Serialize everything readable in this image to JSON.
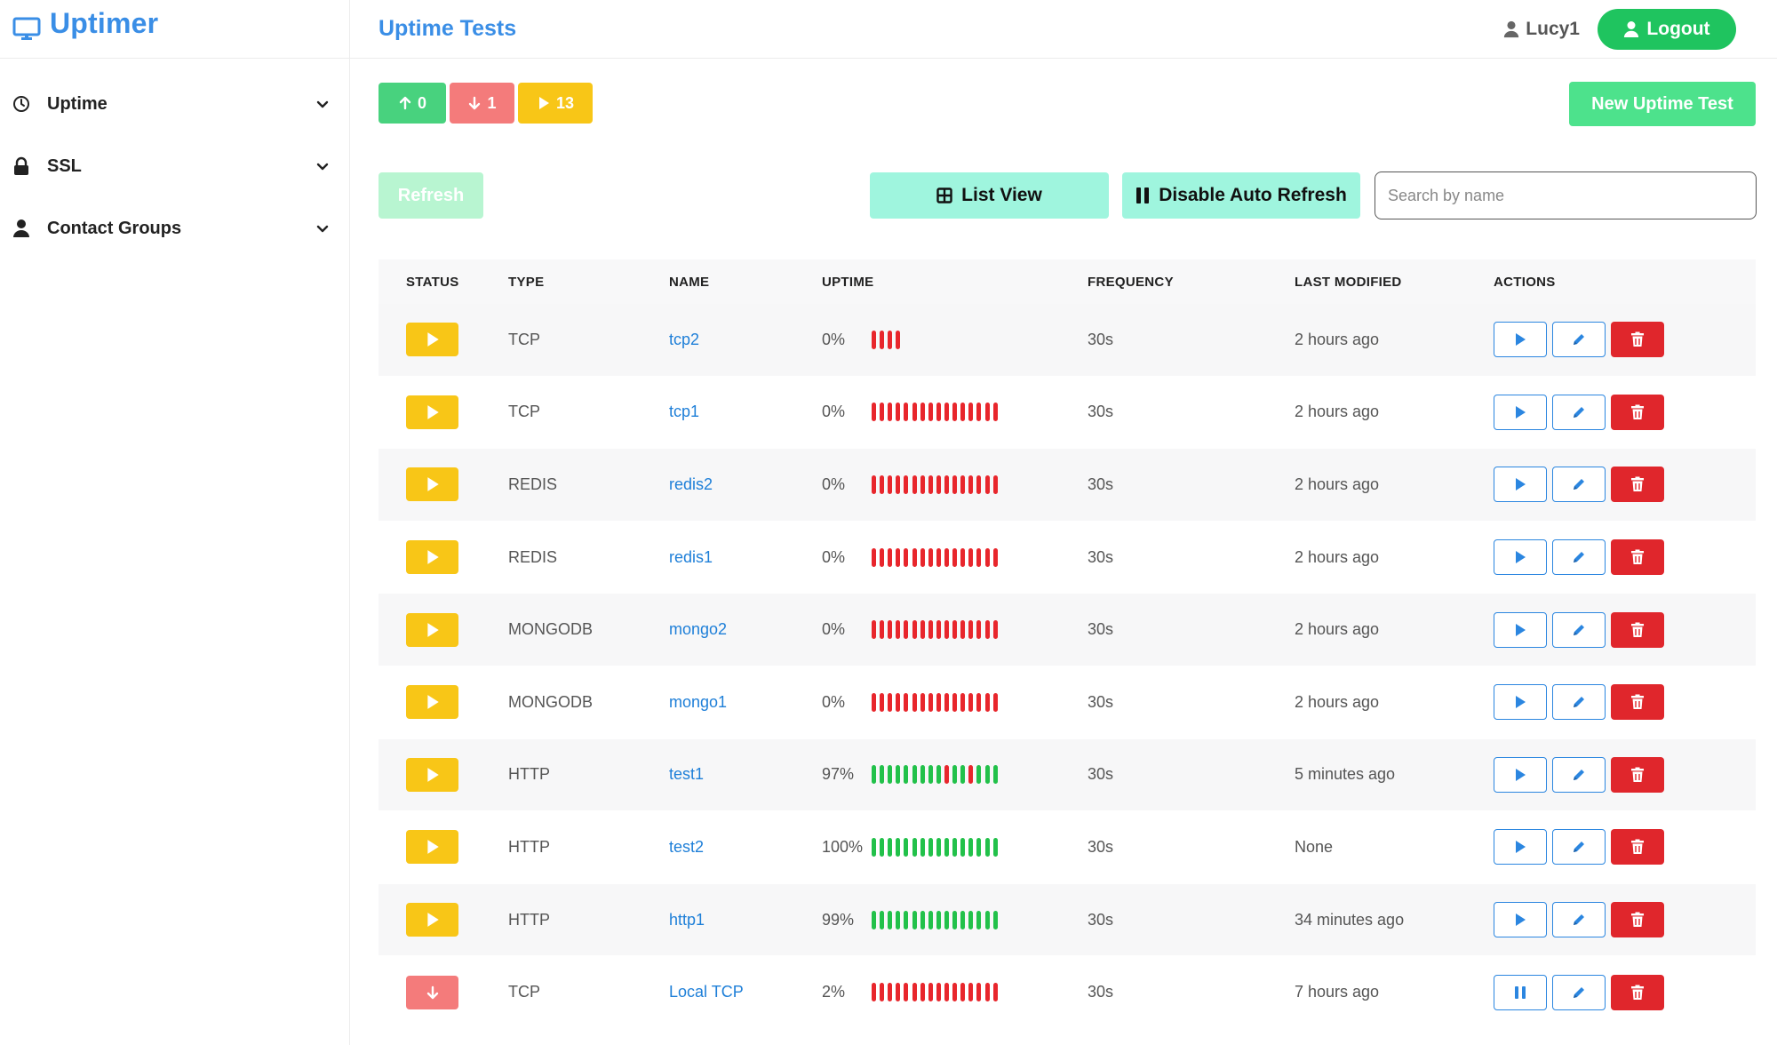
{
  "app": {
    "name": "Uptimer"
  },
  "sidebar": {
    "items": [
      {
        "label": "Uptime",
        "icon": "clock-icon"
      },
      {
        "label": "SSL",
        "icon": "lock-icon"
      },
      {
        "label": "Contact Groups",
        "icon": "user-icon"
      }
    ]
  },
  "header": {
    "title": "Uptime Tests",
    "user": "Lucy1",
    "logout_label": "Logout"
  },
  "summary": {
    "up_count": "0",
    "down_count": "1",
    "paused_count": "13"
  },
  "toolbar": {
    "new_test_label": "New Uptime Test",
    "refresh_label": "Refresh",
    "list_view_label": "List View",
    "auto_refresh_label": "Disable Auto Refresh",
    "search_placeholder": "Search by name"
  },
  "table": {
    "headers": [
      "STATUS",
      "TYPE",
      "NAME",
      "UPTIME",
      "FREQUENCY",
      "LAST MODIFIED",
      "ACTIONS"
    ],
    "rows": [
      {
        "status": "paused",
        "type": "TCP",
        "name": "tcp2",
        "uptime": "0%",
        "heartbeats": "FFFF",
        "frequency": "30s",
        "last_modified": "2 hours ago"
      },
      {
        "status": "paused",
        "type": "TCP",
        "name": "tcp1",
        "uptime": "0%",
        "heartbeats": "FFFFFFFFFFFFFFFF",
        "frequency": "30s",
        "last_modified": "2 hours ago"
      },
      {
        "status": "paused",
        "type": "REDIS",
        "name": "redis2",
        "uptime": "0%",
        "heartbeats": "FFFFFFFFFFFFFFFF",
        "frequency": "30s",
        "last_modified": "2 hours ago"
      },
      {
        "status": "paused",
        "type": "REDIS",
        "name": "redis1",
        "uptime": "0%",
        "heartbeats": "FFFFFFFFFFFFFFFF",
        "frequency": "30s",
        "last_modified": "2 hours ago"
      },
      {
        "status": "paused",
        "type": "MONGODB",
        "name": "mongo2",
        "uptime": "0%",
        "heartbeats": "FFFFFFFFFFFFFFFF",
        "frequency": "30s",
        "last_modified": "2 hours ago"
      },
      {
        "status": "paused",
        "type": "MONGODB",
        "name": "mongo1",
        "uptime": "0%",
        "heartbeats": "FFFFFFFFFFFFFFFF",
        "frequency": "30s",
        "last_modified": "2 hours ago"
      },
      {
        "status": "paused",
        "type": "HTTP",
        "name": "test1",
        "uptime": "97%",
        "heartbeats": "OOOOOOOOOFOOFOOO",
        "frequency": "30s",
        "last_modified": "5 minutes ago"
      },
      {
        "status": "paused",
        "type": "HTTP",
        "name": "test2",
        "uptime": "100%",
        "heartbeats": "OOOOOOOOOOOOOOOO",
        "frequency": "30s",
        "last_modified": "None"
      },
      {
        "status": "paused",
        "type": "HTTP",
        "name": "http1",
        "uptime": "99%",
        "heartbeats": "OOOOOOOOOOOOOOOO",
        "frequency": "30s",
        "last_modified": "34 minutes ago"
      },
      {
        "status": "down",
        "type": "TCP",
        "name": "Local TCP",
        "uptime": "2%",
        "heartbeats": "FFFFFFFFFFFFFFFF",
        "frequency": "30s",
        "last_modified": "7 hours ago"
      }
    ]
  },
  "colors": {
    "brand": "#3a8ee6",
    "success": "#1fc45f",
    "danger": "#e0262c",
    "paused": "#f8c617"
  }
}
